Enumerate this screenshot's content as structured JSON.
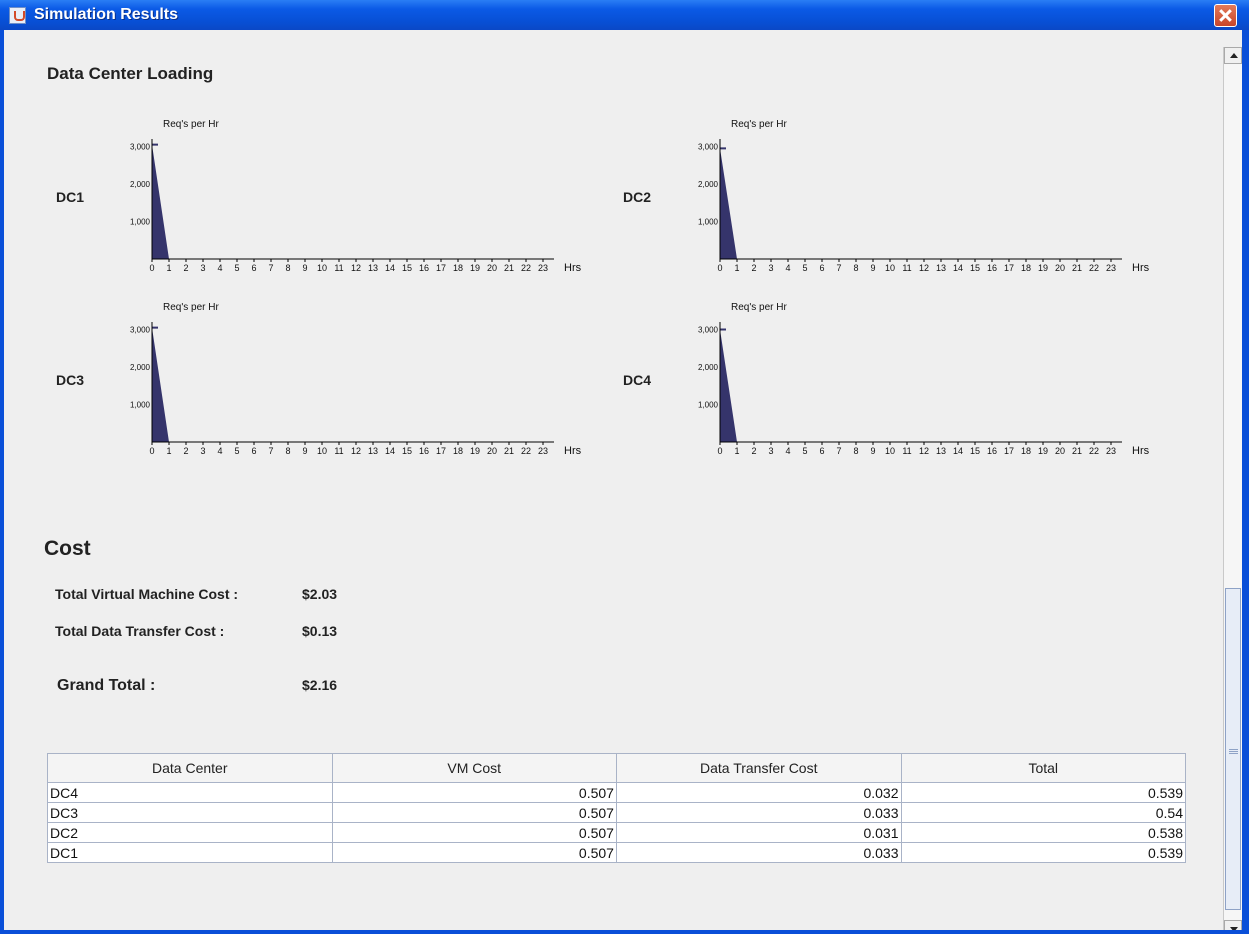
{
  "window": {
    "title": "Simulation Results"
  },
  "loading": {
    "title": "Data Center Loading",
    "y_axis_label": "Req's per Hr",
    "x_axis_unit": "Hrs"
  },
  "cost": {
    "title": "Cost",
    "vm_label": "Total Virtual Machine Cost :",
    "vm_value": "$2.03",
    "transfer_label": "Total Data Transfer Cost :",
    "transfer_value": "$0.13",
    "grand_label": "Grand Total :",
    "grand_value": "$2.16"
  },
  "table": {
    "headers": [
      "Data Center",
      "VM Cost",
      "Data Transfer Cost",
      "Total"
    ],
    "rows": [
      [
        "DC4",
        "0.507",
        "0.032",
        "0.539"
      ],
      [
        "DC3",
        "0.507",
        "0.033",
        "0.54"
      ],
      [
        "DC2",
        "0.507",
        "0.031",
        "0.538"
      ],
      [
        "DC1",
        "0.507",
        "0.033",
        "0.539"
      ]
    ]
  },
  "chart_data": [
    {
      "type": "area",
      "label": "DC1",
      "ylabel": "Req's per Hr",
      "xlabel": "Hrs",
      "ytick_labels": [
        "1,000",
        "2,000",
        "3,000"
      ],
      "xtick_labels": [
        "0",
        "1",
        "2",
        "3",
        "4",
        "5",
        "6",
        "7",
        "8",
        "9",
        "10",
        "11",
        "12",
        "13",
        "14",
        "15",
        "16",
        "17",
        "18",
        "19",
        "20",
        "21",
        "22",
        "23"
      ],
      "x": [
        0,
        1,
        2,
        3,
        4,
        5,
        6,
        7,
        8,
        9,
        10,
        11,
        12,
        13,
        14,
        15,
        16,
        17,
        18,
        19,
        20,
        21,
        22,
        23
      ],
      "values": [
        3050,
        0,
        0,
        0,
        0,
        0,
        0,
        0,
        0,
        0,
        0,
        0,
        0,
        0,
        0,
        0,
        0,
        0,
        0,
        0,
        0,
        0,
        0,
        0
      ]
    },
    {
      "type": "area",
      "label": "DC2",
      "ylabel": "Req's per Hr",
      "xlabel": "Hrs",
      "ytick_labels": [
        "1,000",
        "2,000",
        "3,000"
      ],
      "xtick_labels": [
        "0",
        "1",
        "2",
        "3",
        "4",
        "5",
        "6",
        "7",
        "8",
        "9",
        "10",
        "11",
        "12",
        "13",
        "14",
        "15",
        "16",
        "17",
        "18",
        "19",
        "20",
        "21",
        "22",
        "23"
      ],
      "x": [
        0,
        1,
        2,
        3,
        4,
        5,
        6,
        7,
        8,
        9,
        10,
        11,
        12,
        13,
        14,
        15,
        16,
        17,
        18,
        19,
        20,
        21,
        22,
        23
      ],
      "values": [
        2950,
        0,
        0,
        0,
        0,
        0,
        0,
        0,
        0,
        0,
        0,
        0,
        0,
        0,
        0,
        0,
        0,
        0,
        0,
        0,
        0,
        0,
        0,
        0
      ]
    },
    {
      "type": "area",
      "label": "DC3",
      "ylabel": "Req's per Hr",
      "xlabel": "Hrs",
      "ytick_labels": [
        "1,000",
        "2,000",
        "3,000"
      ],
      "xtick_labels": [
        "0",
        "1",
        "2",
        "3",
        "4",
        "5",
        "6",
        "7",
        "8",
        "9",
        "10",
        "11",
        "12",
        "13",
        "14",
        "15",
        "16",
        "17",
        "18",
        "19",
        "20",
        "21",
        "22",
        "23"
      ],
      "x": [
        0,
        1,
        2,
        3,
        4,
        5,
        6,
        7,
        8,
        9,
        10,
        11,
        12,
        13,
        14,
        15,
        16,
        17,
        18,
        19,
        20,
        21,
        22,
        23
      ],
      "values": [
        3050,
        0,
        0,
        0,
        0,
        0,
        0,
        0,
        0,
        0,
        0,
        0,
        0,
        0,
        0,
        0,
        0,
        0,
        0,
        0,
        0,
        0,
        0,
        0
      ]
    },
    {
      "type": "area",
      "label": "DC4",
      "ylabel": "Req's per Hr",
      "xlabel": "Hrs",
      "ytick_labels": [
        "1,000",
        "2,000",
        "3,000"
      ],
      "xtick_labels": [
        "0",
        "1",
        "2",
        "3",
        "4",
        "5",
        "6",
        "7",
        "8",
        "9",
        "10",
        "11",
        "12",
        "13",
        "14",
        "15",
        "16",
        "17",
        "18",
        "19",
        "20",
        "21",
        "22",
        "23"
      ],
      "x": [
        0,
        1,
        2,
        3,
        4,
        5,
        6,
        7,
        8,
        9,
        10,
        11,
        12,
        13,
        14,
        15,
        16,
        17,
        18,
        19,
        20,
        21,
        22,
        23
      ],
      "values": [
        3000,
        0,
        0,
        0,
        0,
        0,
        0,
        0,
        0,
        0,
        0,
        0,
        0,
        0,
        0,
        0,
        0,
        0,
        0,
        0,
        0,
        0,
        0,
        0
      ]
    }
  ],
  "colors": {
    "chart_fill": "#35346b",
    "axis": "#000000",
    "titlebar": "#0b5ae6"
  }
}
